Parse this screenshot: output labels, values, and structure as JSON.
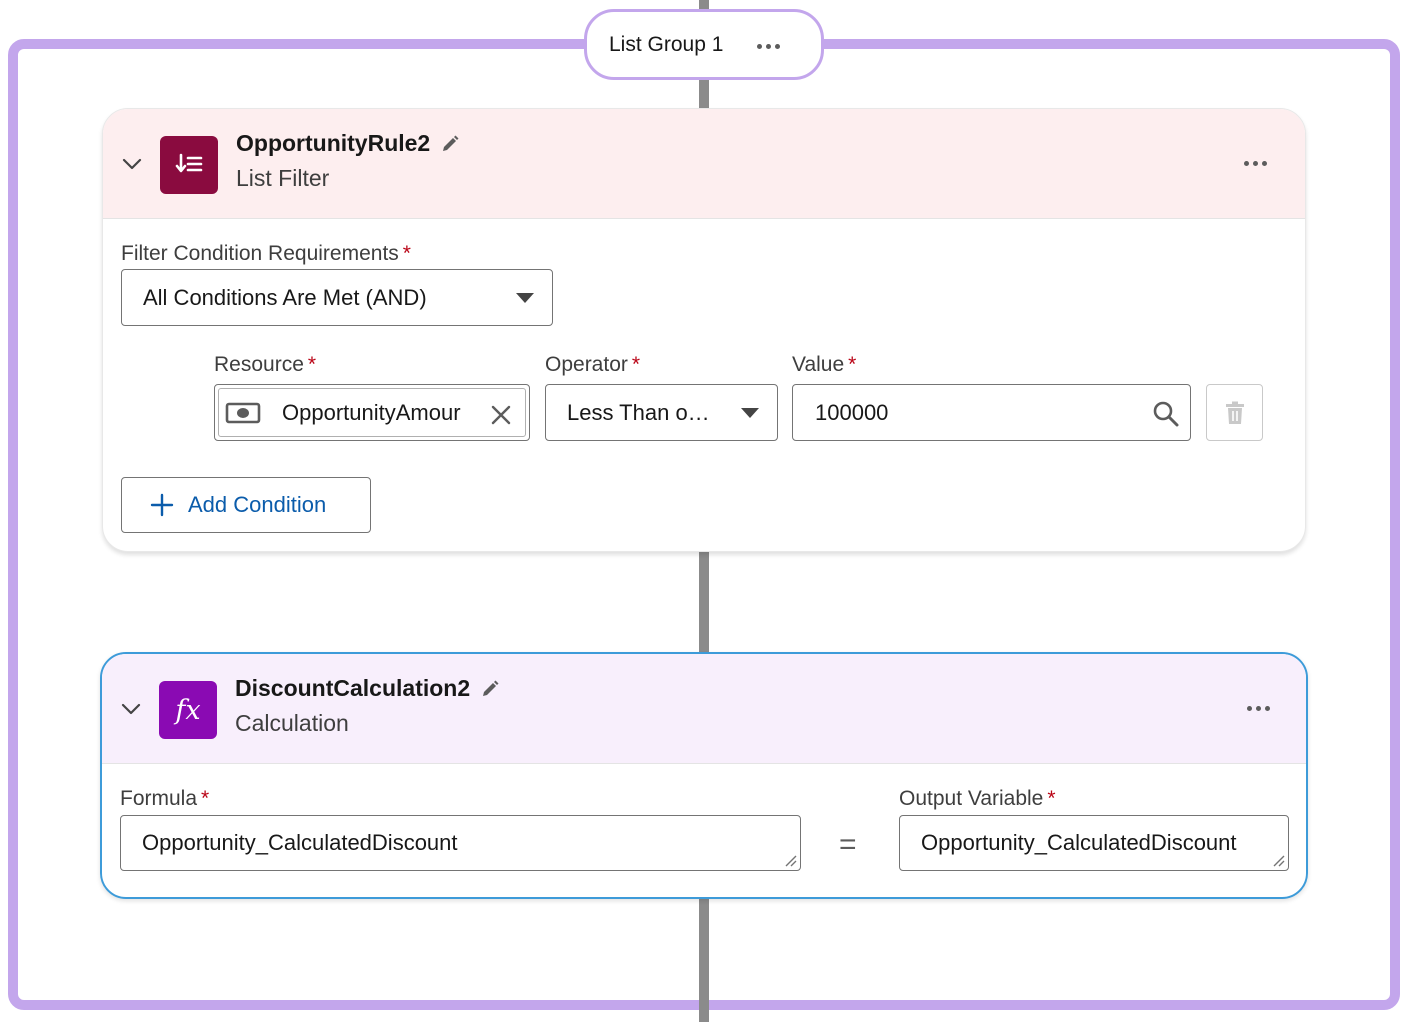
{
  "group": {
    "label": "List Group 1"
  },
  "list_filter": {
    "title": "OpportunityRule2",
    "subtitle": "List Filter",
    "requirements_label": "Filter Condition Requirements",
    "requirements_value": "All Conditions Are Met (AND)",
    "condition": {
      "resource_label": "Resource",
      "resource_value": "OpportunityAmour",
      "operator_label": "Operator",
      "operator_value": "Less Than o…",
      "value_label": "Value",
      "value_value": "100000"
    },
    "add_condition_label": "Add Condition"
  },
  "calculation": {
    "title": "DiscountCalculation2",
    "subtitle": "Calculation",
    "formula_label": "Formula",
    "formula_value": "Opportunity_CalculatedDiscount",
    "equals": "=",
    "output_label": "Output Variable",
    "output_value": "Opportunity_CalculatedDiscount"
  },
  "required_marker": "*",
  "icons": {
    "rule_icon": "list-filter-icon",
    "calc_icon": "formula-fx-icon",
    "fx_glyph": "fx",
    "resource_icon": "currency-icon"
  },
  "colors": {
    "group_border": "#c3a6ec",
    "filter_header_bg": "#fdeeef",
    "filter_icon_bg": "#8a0b3f",
    "calc_header_bg": "#f8effc",
    "calc_icon_bg": "#8a0ab3",
    "selected_border": "#3d9bd9",
    "brand_blue": "#0b5cab",
    "required": "#ba0517"
  }
}
